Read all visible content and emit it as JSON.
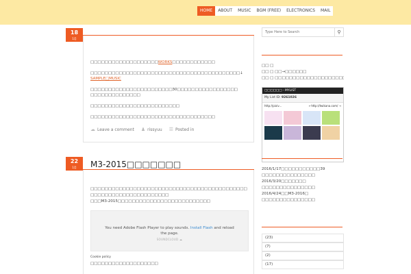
{
  "nav": {
    "items": [
      {
        "label": "HOME",
        "active": true
      },
      {
        "label": "ABOUT",
        "active": false
      },
      {
        "label": "MUSIC",
        "active": false
      },
      {
        "label": "BGM (FREE)",
        "active": false
      },
      {
        "label": "ELECTRONICS",
        "active": false
      },
      {
        "label": "MAIL",
        "active": false
      }
    ]
  },
  "colors": {
    "accent": "#ee5b23",
    "header_bg": "#fde9a3"
  },
  "posts": [
    {
      "day": "18",
      "month": "1月",
      "title": "",
      "lines": [
        {
          "pre": "□□□□□□□□□□□□□□□□□□□",
          "link": "WORKS",
          "post": "□□□□□□□□□□□□"
        },
        {
          "pre": "□□□□□□□□□□□□□□□□□□□□□□□□□□□□□□□□□□□□□□□□□□↓",
          "link": "",
          "post": ""
        },
        {
          "pre": "",
          "link": "SAMPLE□MUSIC",
          "post": ""
        },
        {
          "pre": "□□□□□□□□□□□□□□□□□□□□□□□30□□□□□□□□□□□□□□□□□",
          "link": "",
          "post": ""
        },
        {
          "pre": "□□□□□□□□□□□□□□",
          "link": "",
          "post": ""
        },
        {
          "pre": "□□□□□□□□□□□□□□□□□□□□□□□□□",
          "link": "",
          "post": ""
        },
        {
          "pre": "□□□□□□□□□□□□□□□□□□□□□□□□□□□□□□□□□□□",
          "link": "",
          "post": ""
        }
      ],
      "meta": {
        "comment": "Leave a comment",
        "author": "rissyuu",
        "posted": "Posted in"
      }
    },
    {
      "day": "22",
      "month": "1月",
      "title": "M3-2015□□□□□□□",
      "lines": [
        {
          "pre": "□□□□□□□□□□□□□□□□□□□□□□□□□□□□□□□□□□□□□□□□□□□□",
          "link": "",
          "post": ""
        },
        {
          "pre": "□□□□□□□□□□□□□□□□□□□□□□",
          "link": "",
          "post": ""
        },
        {
          "pre": "□□□M3-2015□□□□□□□□□□□□□□□□□□□□□□□□□□",
          "link": "",
          "post": ""
        }
      ],
      "flash": {
        "msg": "You need Adobe Flash Player to play sounds.",
        "link": "Install Flash",
        "msg2": "and reload the page.",
        "brand": "SOUNDCLOUD"
      },
      "cookie": "Cookie policy",
      "after": "□□□□□□□□□□□□□□□□□□□"
    }
  ],
  "sidebar": {
    "search_placeholder": "Type Here to Search",
    "search_icon": "search-icon",
    "intro": [
      "□□ □",
      "□□ □ □□→□□□□□□",
      "□□ □ □□□□□□□□□□□□□□□□□□□□□□□□□□□□□□□□□□□□□□□"
    ],
    "intro_extra": "□□□□□□□□□□□□",
    "nico": {
      "header": "□□□□□□ - MYLIST",
      "id_label": "My List ID:",
      "id_value": "9261026",
      "url_left": "http://pixiv...",
      "url_right": "←http://twikana.com/ →"
    },
    "news": [
      "2016/1/17□□□□□□□□□□□39",
      "□□□□□□□□□□□□□□□",
      "2016/3/20□□□□□□□",
      "□□□□□□□□□□□□□□□",
      "2016/4/24□□M3-2016□",
      "□□□□□□□□□□□□□□□"
    ],
    "counts": [
      "(23)",
      "(7)",
      "(2)",
      "(17)"
    ]
  }
}
